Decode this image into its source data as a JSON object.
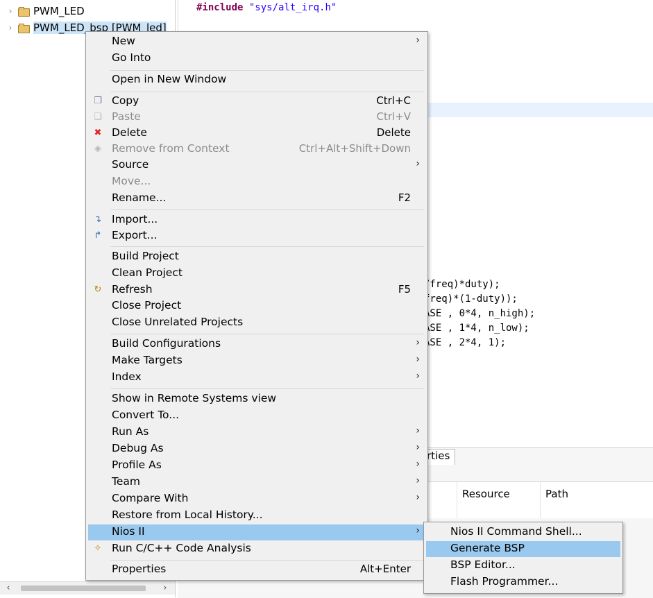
{
  "explorer": {
    "items": [
      {
        "label": "PWM_LED",
        "selected": false
      },
      {
        "label": "PWM_LED_bsp [PWM_led]",
        "selected": true
      }
    ]
  },
  "editor": {
    "include_keyword": "#include",
    "include_path": "\"sys/alt_irq.h\"",
    "lines": [
      "/freq)*duty);",
      "freq)*(1-duty));",
      "ASE , 0*4, n_high);",
      "ASE , 1*4, n_low);",
      "ASE , 2*4, 1);"
    ]
  },
  "bottom_panel": {
    "tab_label": "rties",
    "columns": [
      "Resource",
      "Path"
    ]
  },
  "context_menu": {
    "items": [
      {
        "label": "New",
        "shortcut": "",
        "submenu": true,
        "disabled": false,
        "icon": ""
      },
      {
        "label": "Go Into",
        "shortcut": "",
        "submenu": false,
        "disabled": false,
        "icon": ""
      },
      {
        "label": "Open in New Window",
        "shortcut": "",
        "submenu": false,
        "disabled": false,
        "icon": ""
      },
      {
        "label": "Copy",
        "shortcut": "Ctrl+C",
        "submenu": false,
        "disabled": false,
        "icon": "copy-icon"
      },
      {
        "label": "Paste",
        "shortcut": "Ctrl+V",
        "submenu": false,
        "disabled": true,
        "icon": "paste-icon"
      },
      {
        "label": "Delete",
        "shortcut": "Delete",
        "submenu": false,
        "disabled": false,
        "icon": "delete-icon"
      },
      {
        "label": "Remove from Context",
        "shortcut": "Ctrl+Alt+Shift+Down",
        "submenu": false,
        "disabled": true,
        "icon": "remove-context-icon"
      },
      {
        "label": "Source",
        "shortcut": "",
        "submenu": true,
        "disabled": false,
        "icon": ""
      },
      {
        "label": "Move...",
        "shortcut": "",
        "submenu": false,
        "disabled": true,
        "icon": ""
      },
      {
        "label": "Rename...",
        "shortcut": "F2",
        "submenu": false,
        "disabled": false,
        "icon": ""
      },
      {
        "label": "Import...",
        "shortcut": "",
        "submenu": false,
        "disabled": false,
        "icon": "import-icon"
      },
      {
        "label": "Export...",
        "shortcut": "",
        "submenu": false,
        "disabled": false,
        "icon": "export-icon"
      },
      {
        "label": "Build Project",
        "shortcut": "",
        "submenu": false,
        "disabled": false,
        "icon": ""
      },
      {
        "label": "Clean Project",
        "shortcut": "",
        "submenu": false,
        "disabled": false,
        "icon": ""
      },
      {
        "label": "Refresh",
        "shortcut": "F5",
        "submenu": false,
        "disabled": false,
        "icon": "refresh-icon"
      },
      {
        "label": "Close Project",
        "shortcut": "",
        "submenu": false,
        "disabled": false,
        "icon": ""
      },
      {
        "label": "Close Unrelated Projects",
        "shortcut": "",
        "submenu": false,
        "disabled": false,
        "icon": ""
      },
      {
        "label": "Build Configurations",
        "shortcut": "",
        "submenu": true,
        "disabled": false,
        "icon": ""
      },
      {
        "label": "Make Targets",
        "shortcut": "",
        "submenu": true,
        "disabled": false,
        "icon": ""
      },
      {
        "label": "Index",
        "shortcut": "",
        "submenu": true,
        "disabled": false,
        "icon": ""
      },
      {
        "label": "Show in Remote Systems view",
        "shortcut": "",
        "submenu": false,
        "disabled": false,
        "icon": ""
      },
      {
        "label": "Convert To...",
        "shortcut": "",
        "submenu": false,
        "disabled": false,
        "icon": ""
      },
      {
        "label": "Run As",
        "shortcut": "",
        "submenu": true,
        "disabled": false,
        "icon": ""
      },
      {
        "label": "Debug As",
        "shortcut": "",
        "submenu": true,
        "disabled": false,
        "icon": ""
      },
      {
        "label": "Profile As",
        "shortcut": "",
        "submenu": true,
        "disabled": false,
        "icon": ""
      },
      {
        "label": "Team",
        "shortcut": "",
        "submenu": true,
        "disabled": false,
        "icon": ""
      },
      {
        "label": "Compare With",
        "shortcut": "",
        "submenu": true,
        "disabled": false,
        "icon": ""
      },
      {
        "label": "Restore from Local History...",
        "shortcut": "",
        "submenu": false,
        "disabled": false,
        "icon": ""
      },
      {
        "label": "Nios II",
        "shortcut": "",
        "submenu": true,
        "disabled": false,
        "icon": "",
        "hover": true
      },
      {
        "label": "Run C/C++ Code Analysis",
        "shortcut": "",
        "submenu": false,
        "disabled": false,
        "icon": "code-analysis-icon"
      },
      {
        "label": "Properties",
        "shortcut": "Alt+Enter",
        "submenu": false,
        "disabled": false,
        "icon": ""
      }
    ]
  },
  "nios_submenu": {
    "items": [
      {
        "label": "Nios II Command Shell...",
        "hover": false
      },
      {
        "label": "Generate BSP",
        "hover": true
      },
      {
        "label": "BSP Editor...",
        "hover": false
      },
      {
        "label": "Flash Programmer...",
        "hover": false
      }
    ]
  },
  "colors": {
    "menu_bg": "#f0f0f0",
    "hover": "#99c9ef",
    "keyword": "#7f0055",
    "string": "#2a00ff",
    "delete_icon": "#e02424"
  }
}
